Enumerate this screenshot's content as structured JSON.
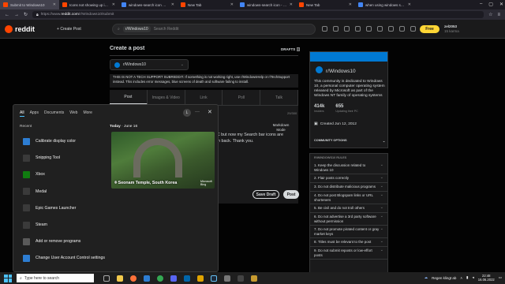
{
  "browser": {
    "tabs": [
      {
        "label": "Submit to Windows10",
        "active": true,
        "color": "#ff4500"
      },
      {
        "label": "Icons not showing up in search b",
        "active": false,
        "color": "#ff4500"
      },
      {
        "label": "windows-search icon missing - G",
        "active": false,
        "color": "#4285f4"
      },
      {
        "label": "New Tab",
        "active": false,
        "color": "#ff4500"
      },
      {
        "label": "windows-search icon - Google",
        "active": false,
        "color": "#4285f4"
      },
      {
        "label": "New Tab",
        "active": false,
        "color": "#ff4500"
      },
      {
        "label": "when using windows search",
        "active": false,
        "color": "#4285f4"
      }
    ],
    "url_host": "https://www.",
    "url_domain": "reddit.com",
    "url_path": "/r/Windows10/submit"
  },
  "reddit": {
    "logo": "reddit",
    "create_post": "Create Post",
    "search_chip": "r/Windows10",
    "search_placeholder": "Search Reddit",
    "free_label": "Free",
    "username": "zel2053",
    "karma": "15 karma"
  },
  "main": {
    "title": "Create a post",
    "drafts": "DRAFTS",
    "drafts_count": "0",
    "community": "r/Windows10",
    "notice": "THIS IS NOT A TECH SUPPORT SUBREDDIT. If something is not working right, use r/WindowsHelp or r/TechSupport instead. This includes error messages, blue screens of death and software failing to install.",
    "tabs": [
      "Post",
      "Images & Video",
      "Link",
      "Poll",
      "Talk"
    ],
    "charcount": "29/300",
    "markdown": "Markdown Mode",
    "body_line1": "n my PC but now my Search bar icons are",
    "body_line2": "get them back. Thank you.",
    "save_draft": "Save Draft",
    "post": "Post"
  },
  "sidebar": {
    "name": "r/Windows10",
    "description": "This community is dedicated to Windows 10, a personal computer operating system released by Microsoft as part of the Windows NT family of operating systems",
    "members": "414k",
    "members_label": "Insiders",
    "online": "655",
    "online_label": "Updating their PC",
    "created": "Created Jun 12, 2012",
    "options": "COMMUNITY OPTIONS"
  },
  "rules": {
    "title": "R/WINDOWS10 RULES",
    "items": [
      "1. Keep the discussion related to Windows 10",
      "2. Flair posts correctly",
      "3. Do not distribute malicious programs",
      "4. Do not post Blogspam links or URL shorteners",
      "5. Be civil and do not troll others",
      "6. Do not advertise a 3rd party software without permission",
      "7. Do not promote pirated content or gray market keys",
      "8. Titles must be relevant to the post",
      "9. Do not submit reposts or low-effort posts"
    ]
  },
  "startmenu": {
    "tabs": [
      "All",
      "Apps",
      "Documents",
      "Web",
      "More"
    ],
    "avatar": "L",
    "recent_label": "Recent",
    "apps": [
      {
        "label": "Calibrate display color",
        "color": "#2d7dd2"
      },
      {
        "label": "Snipping Tool",
        "color": "#3a3a3a"
      },
      {
        "label": "Xbox",
        "color": "#107c10"
      },
      {
        "label": "Medal",
        "color": "#3a3a3a"
      },
      {
        "label": "Epic Games Launcher",
        "color": "#3a3a3a"
      },
      {
        "label": "Steam",
        "color": "#3a3a3a"
      },
      {
        "label": "Add or remove programs",
        "color": "#5a5a5a"
      },
      {
        "label": "Change User Account Control settings",
        "color": "#2d7dd2"
      }
    ],
    "today": "Today",
    "date": "June 16",
    "photo_caption": "Seonam Temple, South Korea",
    "photo_brand": "Microsoft Bing"
  },
  "taskbar": {
    "search_placeholder": "Type here to search",
    "weather": "Regen klingt ab",
    "time": "22:48",
    "date": "16.06.2022"
  }
}
